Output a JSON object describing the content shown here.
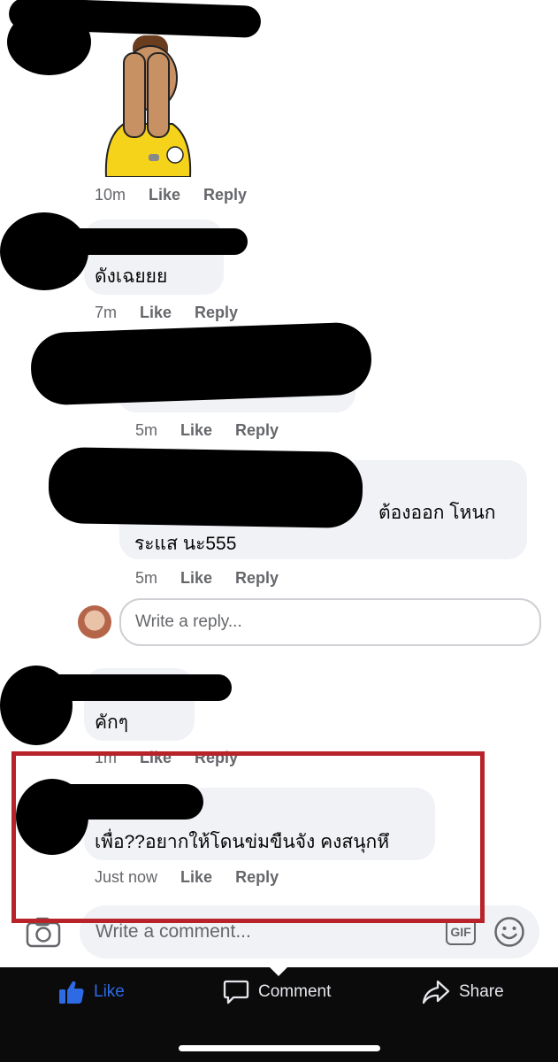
{
  "comments": [
    {
      "time": "10m",
      "like": "Like",
      "reply": "Reply"
    },
    {
      "text": "ดังเฉยยย",
      "time": "7m",
      "like": "Like",
      "reply": "Reply"
    },
    {
      "time": "5m",
      "like": "Like",
      "reply": "Reply"
    },
    {
      "text_line1": "ต้องออก โหนก",
      "text_line2": "ระแส นะ555",
      "time": "5m",
      "like": "Like",
      "reply": "Reply"
    },
    {
      "text": "คักๆ",
      "time": "1m",
      "like": "Like",
      "reply": "Reply"
    },
    {
      "text": "เพื่อ??อยากให้โดนข่มขืนจัง คงสนุกหึ",
      "time": "Just now",
      "like": "Like",
      "reply": "Reply"
    }
  ],
  "reply_input": {
    "placeholder": "Write a reply..."
  },
  "comment_input": {
    "placeholder": "Write a comment...",
    "gif_label": "GIF"
  },
  "action_bar": {
    "like": "Like",
    "comment": "Comment",
    "share": "Share"
  },
  "colors": {
    "highlight": "#b8232a",
    "like_blue": "#2d6ae3",
    "bubble": "#f0f2f5"
  },
  "icons": [
    "camera-icon",
    "gif-icon",
    "emoji-icon",
    "thumbs-up-icon",
    "comment-icon",
    "share-icon"
  ]
}
